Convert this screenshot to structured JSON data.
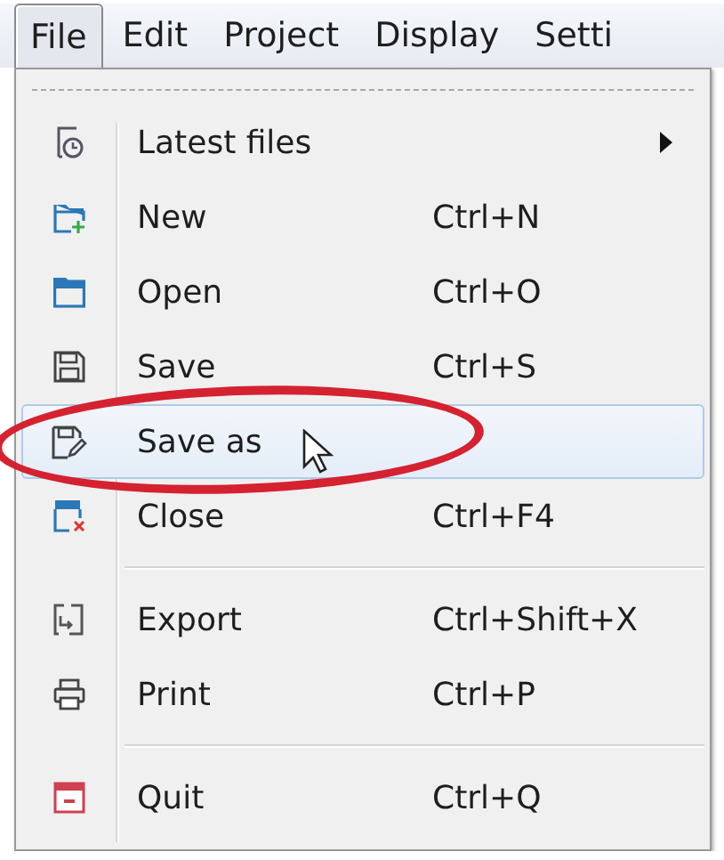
{
  "menubar": [
    {
      "label": "File",
      "selected": true
    },
    {
      "label": "Edit",
      "selected": false
    },
    {
      "label": "Project",
      "selected": false
    },
    {
      "label": "Display",
      "selected": false
    },
    {
      "label": "Setti",
      "selected": false
    }
  ],
  "menu": [
    {
      "kind": "submenu",
      "label": "Latest files",
      "selected": false
    },
    {
      "kind": "command",
      "label": "New",
      "shortcut": "Ctrl+N",
      "selected": false
    },
    {
      "kind": "command",
      "label": "Open",
      "shortcut": "Ctrl+O",
      "selected": false
    },
    {
      "kind": "command",
      "label": "Save",
      "shortcut": "Ctrl+S",
      "selected": false
    },
    {
      "kind": "command",
      "label": "Save as",
      "selected": true
    },
    {
      "kind": "command",
      "label": "Close",
      "shortcut": "Ctrl+F4",
      "selected": false
    },
    {
      "kind": "separator"
    },
    {
      "kind": "command",
      "label": "Export",
      "shortcut": "Ctrl+Shift+X",
      "selected": false
    },
    {
      "kind": "command",
      "label": "Print",
      "shortcut": "Ctrl+P",
      "selected": false
    },
    {
      "kind": "separator"
    },
    {
      "kind": "command",
      "label": "Quit",
      "shortcut": "Ctrl+Q",
      "selected": false
    }
  ]
}
